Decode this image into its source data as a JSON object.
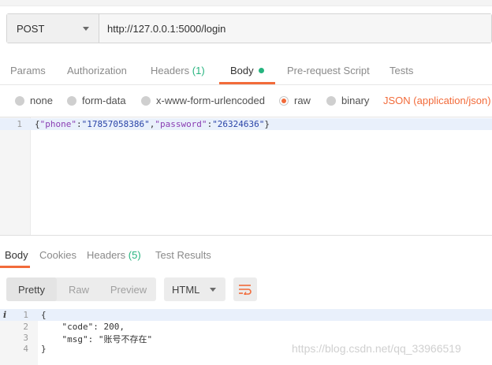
{
  "request": {
    "method": "POST",
    "url": "http://127.0.0.1:5000/login"
  },
  "request_tabs": {
    "params": "Params",
    "authorization": "Authorization",
    "headers": "Headers",
    "headers_count": "(1)",
    "body": "Body",
    "prerequest": "Pre-request Script",
    "tests": "Tests"
  },
  "body_modes": {
    "none": "none",
    "form_data": "form-data",
    "urlencoded": "x-www-form-urlencoded",
    "raw": "raw",
    "binary": "binary",
    "content_type": "JSON (application/json)"
  },
  "request_body": {
    "line_number": "1",
    "brace_open": "{",
    "key_phone": "\"phone\"",
    "colon1": ":",
    "val_phone": "\"17857058386\"",
    "comma": ",",
    "key_password": "\"password\"",
    "colon2": ":",
    "val_password": "\"26324636\"",
    "brace_close": "}"
  },
  "response_tabs": {
    "body": "Body",
    "cookies": "Cookies",
    "headers": "Headers",
    "headers_count": "(5)",
    "test_results": "Test Results"
  },
  "view_modes": {
    "pretty": "Pretty",
    "raw": "Raw",
    "preview": "Preview",
    "format": "HTML"
  },
  "response_body": {
    "info_marker": "i",
    "lines": [
      {
        "num": "1",
        "text": "{"
      },
      {
        "num": "2",
        "text": "    \"code\": 200,"
      },
      {
        "num": "3",
        "text": "    \"msg\": \"账号不存在\""
      },
      {
        "num": "4",
        "text": "}"
      }
    ]
  },
  "watermark": "https://blog.csdn.net/qq_33966519",
  "colors": {
    "accent": "#f26b3a",
    "count_green": "#26b47f"
  }
}
